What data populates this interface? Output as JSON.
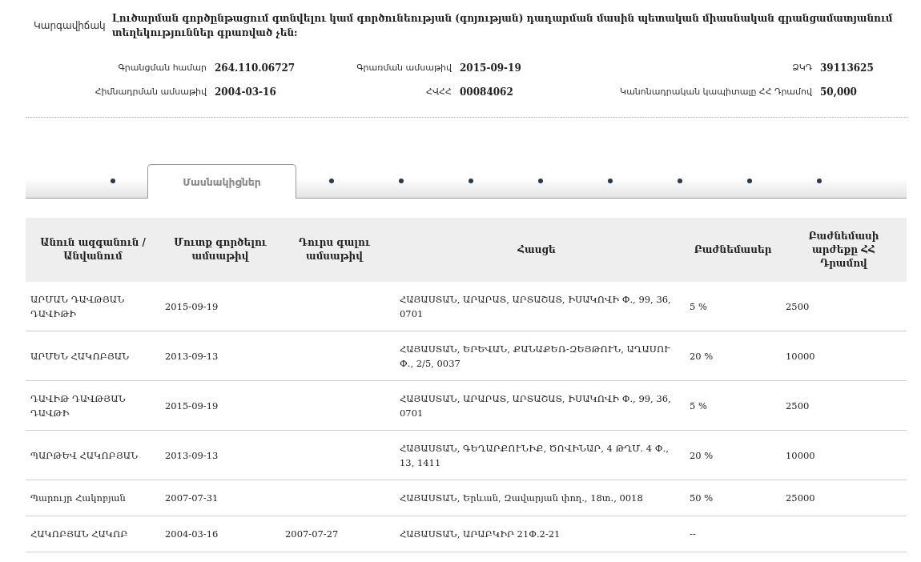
{
  "status": {
    "label": "Կարգավիճակ",
    "text": "Լուծարման գործընթացում գտնվելու կամ գործունեության (գոյության) դադարման մասին պետական միասնական գրանցամատյանում տեղեկություններ գրառված չեն:"
  },
  "info": [
    [
      {
        "label": "Գրանցման համար",
        "value": "264.110.06727"
      },
      {
        "label": "Գրառման ամսաթիվ",
        "value": "2015-09-19"
      },
      {
        "label": "ՁԿԴ",
        "value": "39113625"
      }
    ],
    [
      {
        "label": "Հիմնադրման ամսաթիվ",
        "value": "2004-03-16"
      },
      {
        "label": "ՀՎՀՀ",
        "value": "00084062"
      },
      {
        "label": "Կանոնադրական կապիտալը ՀՀ Դրամով",
        "value": "50,000"
      }
    ]
  ],
  "tabs": [
    {
      "kind": "dot",
      "selected": false
    },
    {
      "kind": "text",
      "label": "Մասնակիցներ",
      "selected": true
    },
    {
      "kind": "dot",
      "selected": false
    },
    {
      "kind": "dot",
      "selected": false
    },
    {
      "kind": "dot",
      "selected": false
    },
    {
      "kind": "dot",
      "selected": false
    },
    {
      "kind": "dot",
      "selected": false
    },
    {
      "kind": "dot",
      "selected": false
    },
    {
      "kind": "dot",
      "selected": false
    },
    {
      "kind": "dot",
      "selected": false
    }
  ],
  "table": {
    "columns": [
      "Անուն ազգանուն / Անվանում",
      "Մուտք գործելու ամսաթիվ",
      "Դուրս գալու ամսաթիվ",
      "Հասցե",
      "Բաժնեմասեր",
      "Բաժնեմասի արժեքը ՀՀ Դրամով"
    ],
    "rows": [
      [
        "ԱՐՄԱՆ ԴԱՎԹՅԱՆ ԴԱՎԻԹԻ",
        "2015-09-19",
        "",
        "ՀԱՅԱՍՏԱՆ, ԱՐԱՐԱՏ, ԱՐՏԱՇԱՏ, ԻՍԱԿՈՎԻ Փ., 99, 36, 0701",
        "5 %",
        "2500"
      ],
      [
        "ԱՐՄԵՆ ՀԱԿՈԲՅԱՆ",
        "2013-09-13",
        "",
        "ՀԱՅԱՍՏԱՆ, ԵՐԵՎԱՆ, ՔԱՆԱՔԵՌ-ԶԵՅԹՈՒՆ, ԱՂԱՍՈՒ Փ., 2/5, 0037",
        "20 %",
        "10000"
      ],
      [
        "ԴԱՎԻԹ ԴԱՎԹՅԱՆ ԴԱՎԹԻ",
        "2015-09-19",
        "",
        "ՀԱՅԱՍՏԱՆ, ԱՐԱՐԱՏ, ԱՐՏԱՇԱՏ, ԻՍԱԿՈՎԻ Փ., 99, 36, 0701",
        "5 %",
        "2500"
      ],
      [
        "ՊԱՐԹԵՎ ՀԱԿՈԲՅԱՆ",
        "2013-09-13",
        "",
        "ՀԱՅԱՍՏԱՆ, ԳԵՂԱՐՔՈՒՆԻՔ, ԾՈՎԻՆԱՐ, 4 ԹՂՄ. 4 Փ., 13, 1411",
        "20 %",
        "10000"
      ],
      [
        "Պարույր Հակոբյան",
        "2007-07-31",
        "",
        "ՀԱՅԱՍՏԱՆ, Երևան, Զավարյան փող., 18տ., 0018",
        "50 %",
        "25000"
      ],
      [
        "ՀԱԿՈԲՅԱՆ ՀԱԿՈԲ",
        "2004-03-16",
        "2007-07-27",
        "ՀԱՅԱՍՏԱՆ, ԱՐԱԲԿԻՐ 21Փ.2-21",
        "--",
        ""
      ]
    ]
  }
}
